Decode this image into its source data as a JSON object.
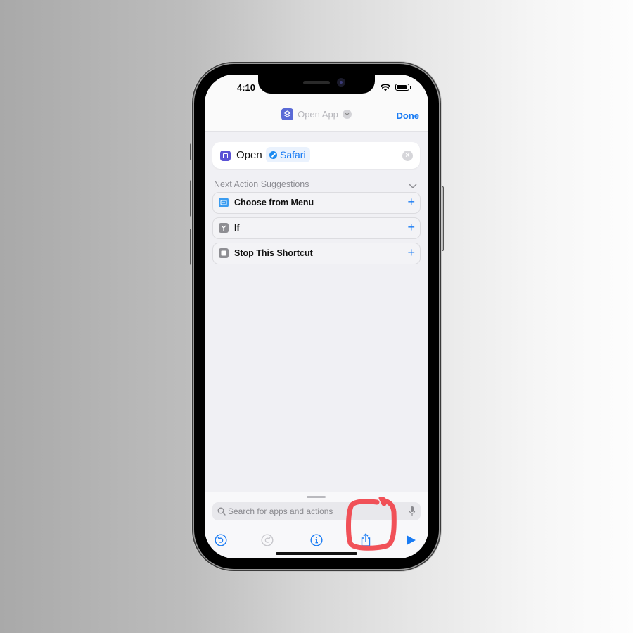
{
  "status_bar": {
    "time": "4:10"
  },
  "nav": {
    "title": "Open App",
    "done_label": "Done"
  },
  "action": {
    "verb": "Open",
    "app_name": "Safari"
  },
  "suggestions": {
    "header": "Next Action Suggestions",
    "items": [
      {
        "label": "Choose from Menu",
        "icon": "menu-icon",
        "color": "#3b9cf0"
      },
      {
        "label": "If",
        "icon": "branch-icon",
        "color": "#8e8e93"
      },
      {
        "label": "Stop This Shortcut",
        "icon": "stop-icon",
        "color": "#8e8e93"
      }
    ]
  },
  "search": {
    "placeholder": "Search for apps and actions"
  },
  "toolbar": {
    "buttons": [
      "undo",
      "redo",
      "info",
      "share",
      "run"
    ]
  },
  "colors": {
    "accent": "#1a7cf4",
    "annotation": "#f0424a"
  }
}
